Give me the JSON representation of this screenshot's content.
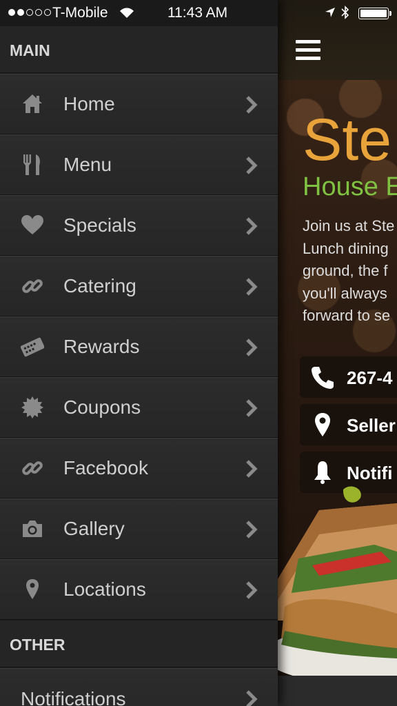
{
  "status_bar": {
    "carrier": "T-Mobile",
    "time": "11:43 AM"
  },
  "drawer": {
    "sections": [
      {
        "title": "MAIN"
      },
      {
        "title": "OTHER"
      }
    ],
    "items": [
      {
        "label": "Home",
        "icon": "home-icon"
      },
      {
        "label": "Menu",
        "icon": "fork-knife-icon"
      },
      {
        "label": "Specials",
        "icon": "heart-icon"
      },
      {
        "label": "Catering",
        "icon": "link-icon"
      },
      {
        "label": "Rewards",
        "icon": "ticket-icon"
      },
      {
        "label": "Coupons",
        "icon": "badge-icon"
      },
      {
        "label": "Facebook",
        "icon": "link-icon"
      },
      {
        "label": "Gallery",
        "icon": "camera-icon"
      },
      {
        "label": "Locations",
        "icon": "map-pin-icon"
      },
      {
        "label": "Notifications",
        "icon": ""
      }
    ]
  },
  "content": {
    "title": "Ste",
    "subtitle": "House E",
    "description_lines": [
      "Join us at Ste",
      "Lunch dining",
      "ground, the f",
      "you'll always",
      "forward to se"
    ],
    "buttons": [
      {
        "label": "267-4",
        "icon": "phone-icon"
      },
      {
        "label": "Seller",
        "icon": "map-pin-icon"
      },
      {
        "label": "Notifi",
        "icon": "bell-icon"
      }
    ]
  },
  "colors": {
    "title": "#e8a33a",
    "subtitle": "#7fc241",
    "drawer_bg": "#1d1d1d",
    "item_text": "#cfcfcf"
  }
}
